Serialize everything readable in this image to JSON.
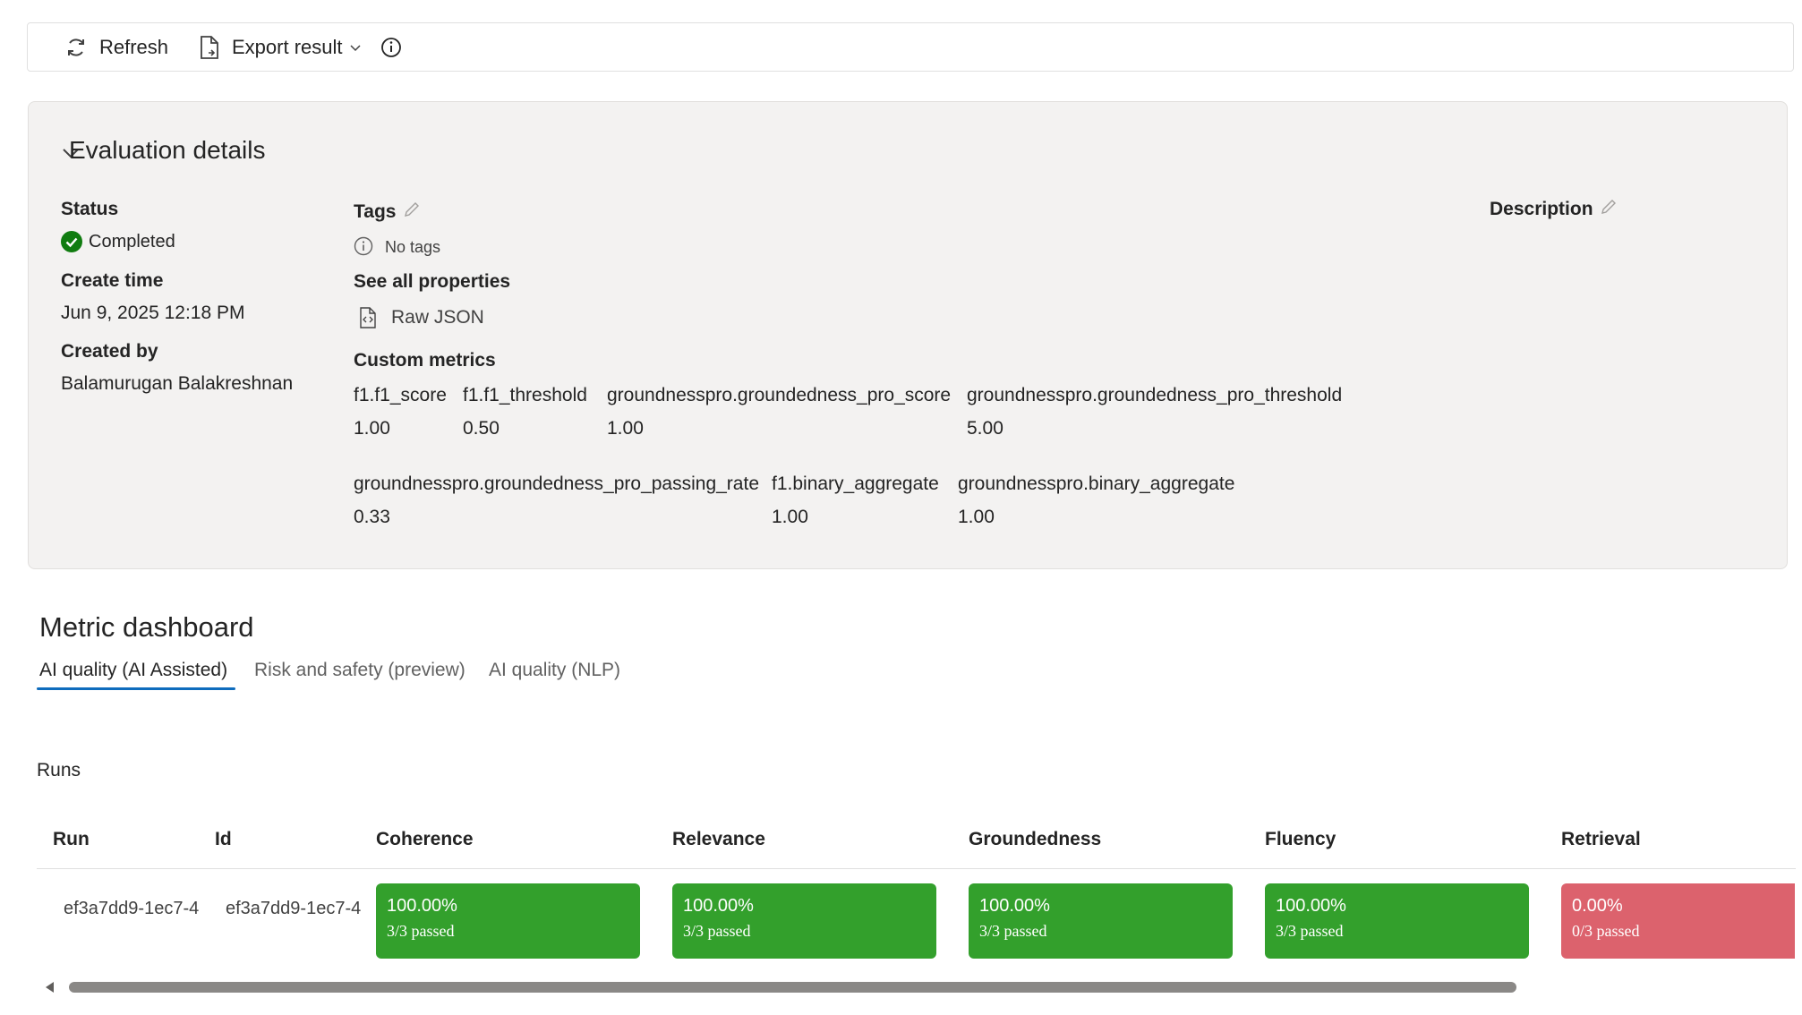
{
  "toolbar": {
    "refresh_label": "Refresh",
    "export_label": "Export result"
  },
  "evaluation": {
    "title": "Evaluation details",
    "status_label": "Status",
    "status_value": "Completed",
    "create_time_label": "Create time",
    "create_time_value": "Jun 9, 2025 12:18 PM",
    "created_by_label": "Created by",
    "created_by_value": "Balamurugan Balakreshnan",
    "tags_label": "Tags",
    "no_tags": "No tags",
    "see_all_properties": "See all properties",
    "raw_json": "Raw JSON",
    "custom_metrics_label": "Custom metrics",
    "description_label": "Description",
    "metrics_row1": [
      {
        "name": "f1.f1_score",
        "value": "1.00"
      },
      {
        "name": "f1.f1_threshold",
        "value": "0.50"
      },
      {
        "name": "groundnesspro.groundedness_pro_score",
        "value": "1.00"
      },
      {
        "name": "groundnesspro.groundedness_pro_threshold",
        "value": "5.00"
      }
    ],
    "metrics_row2": [
      {
        "name": "groundnesspro.groundedness_pro_passing_rate",
        "value": "0.33"
      },
      {
        "name": "f1.binary_aggregate",
        "value": "1.00"
      },
      {
        "name": "groundnesspro.binary_aggregate",
        "value": "1.00"
      }
    ]
  },
  "dashboard": {
    "title": "Metric dashboard",
    "tabs": [
      {
        "label": "AI quality (AI Assisted)",
        "active": true
      },
      {
        "label": "Risk and safety (preview)",
        "active": false
      },
      {
        "label": "AI quality (NLP)",
        "active": false
      }
    ],
    "runs_title": "Runs",
    "columns": [
      "Run",
      "Id",
      "Coherence",
      "Relevance",
      "Groundedness",
      "Fluency",
      "Retrieval"
    ],
    "row": {
      "run": "ef3a7dd9-1ec7-4",
      "id": "ef3a7dd9-1ec7-4",
      "tiles": [
        {
          "pct": "100.00%",
          "passed": "3/3 passed",
          "status": "pass"
        },
        {
          "pct": "100.00%",
          "passed": "3/3 passed",
          "status": "pass"
        },
        {
          "pct": "100.00%",
          "passed": "3/3 passed",
          "status": "pass"
        },
        {
          "pct": "100.00%",
          "passed": "3/3 passed",
          "status": "pass"
        },
        {
          "pct": "0.00%",
          "passed": "0/3 passed",
          "status": "fail"
        }
      ]
    }
  },
  "colors": {
    "pass": "#33a02c",
    "fail": "#dc626d",
    "accent": "#0f6cbd"
  }
}
